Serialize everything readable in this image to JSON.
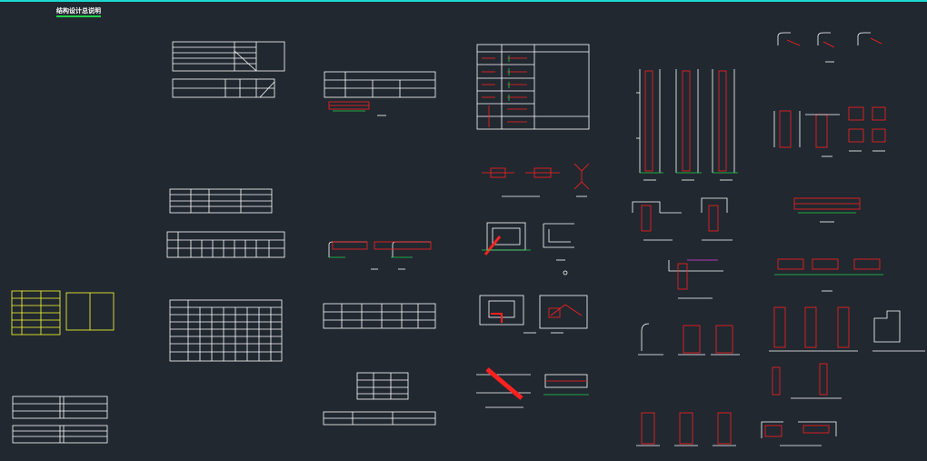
{
  "drawing": {
    "title": "结构设计总说明",
    "colors": {
      "background": "#212830",
      "frame": "#19d9d0",
      "line": "#ffffff",
      "rebar": "#ff2020",
      "dimension": "#22d04a",
      "highlight": "#ffff33",
      "accent": "#e040e0"
    }
  }
}
